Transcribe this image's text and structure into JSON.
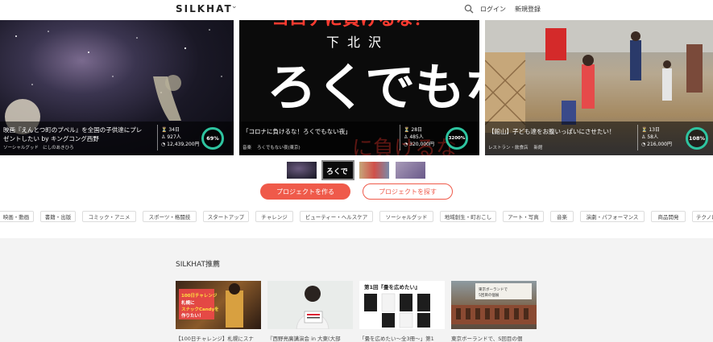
{
  "header": {
    "logo": "SILKHAT",
    "logo_caret": "⌄",
    "login": "ログイン",
    "signup": "新規登録"
  },
  "hero": [
    {
      "title_line1": "映画『えんとつ町のプペル』を全国の子供達にプレ",
      "title_line2": "ゼントしたい by キングコング西野",
      "category": "ソーシャルグッド",
      "owner": "にしのあきひろ",
      "days": "34日",
      "supporters": "927人",
      "amount": "12,439,200円",
      "percent": "69%"
    },
    {
      "title_line1": "「コロナに負けるな！ろくでもない夜」",
      "title_line2": "",
      "category": "音楽",
      "owner": "ろくでもない夜(東京)",
      "days": "28日",
      "supporters": "485人",
      "amount": "320,000円",
      "percent": "3200%"
    },
    {
      "title_line1": "【館山】子ども達をお腹いっぱいにさせたい！",
      "title_line2": "",
      "category": "レストラン・飲食店",
      "owner": "新館",
      "days": "13日",
      "supporters": "58人",
      "amount": "216,000円",
      "percent": "108%"
    }
  ],
  "buttons": {
    "create": "プロジェクトを作る",
    "explore": "プロジェクトを探す"
  },
  "categories": [
    "映画・動画",
    "書籍・出版",
    "コミック・アニメ",
    "スポーツ・格闘技",
    "スタートアップ",
    "チャレンジ",
    "ビューティー・ヘルスケア",
    "ソーシャルグッド",
    "地域創生・町おこし",
    "アート・写真",
    "音楽",
    "演劇・パフォーマンス",
    "商品開発",
    "テクノロ"
  ],
  "recommend": {
    "title": "SILKHAT推薦",
    "items": [
      {
        "text": "【100日チャレンジ】札幌にスナ",
        "thumb_caption": "100日チャレンジ 札幌にスナックCandyを作りたい！"
      },
      {
        "text": "『西野亮廣講演会 in 大東(大部",
        "thumb_caption": ""
      },
      {
        "text": "「畳を広めたい～全3冊～」第1",
        "thumb_caption": "第1回『畳を広めたい』"
      },
      {
        "text": "東京ボーランドで、S回目の個",
        "thumb_caption": ""
      }
    ]
  },
  "colors": {
    "accent": "#ef5a4a",
    "ring": "#2ec4a0"
  }
}
